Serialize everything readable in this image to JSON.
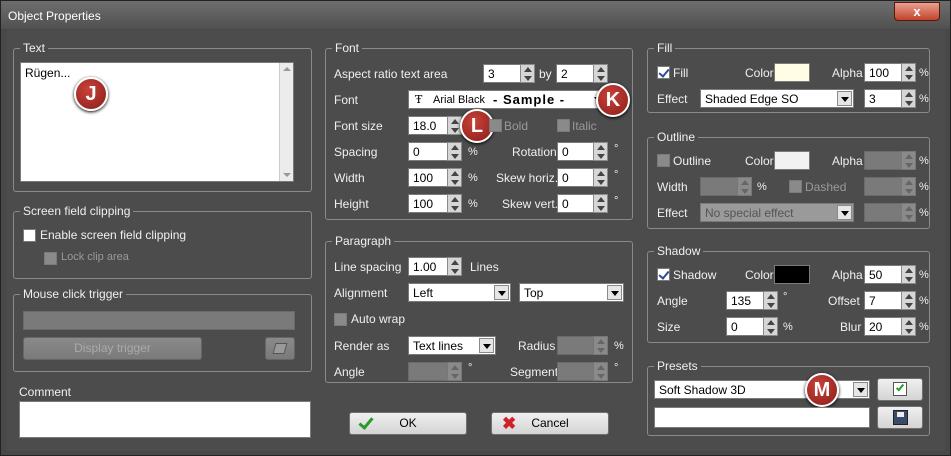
{
  "window": {
    "title": "Object Properties",
    "close_glyph": "x"
  },
  "text_group": {
    "title": "Text",
    "content": "Rügen..."
  },
  "clip_group": {
    "title": "Screen field clipping",
    "enable_label": "Enable screen field clipping",
    "lock_label": "Lock clip area"
  },
  "trigger_group": {
    "title": "Mouse click trigger",
    "trigger_value": "",
    "display_button": "Display trigger"
  },
  "comment": {
    "label": "Comment",
    "value": ""
  },
  "font_group": {
    "title": "Font",
    "aspect_label": "Aspect ratio text area",
    "aspect_a": "3",
    "by_label": "by",
    "aspect_b": "2",
    "font_label": "Font",
    "font_name": "Arial Black",
    "font_sample": "- Sample -",
    "size_label": "Font size",
    "size_value": "18.0",
    "bold_label": "Bold",
    "italic_label": "Italic",
    "spacing_label": "Spacing",
    "spacing_value": "0",
    "rotation_label": "Rotation",
    "rotation_value": "0",
    "width_label": "Width",
    "width_value": "100",
    "skewh_label": "Skew horiz.",
    "skewh_value": "0",
    "height_label": "Height",
    "height_value": "100",
    "skewv_label": "Skew vert.",
    "skewv_value": "0",
    "pct": "%",
    "deg": "°"
  },
  "paragraph_group": {
    "title": "Paragraph",
    "linespacing_label": "Line spacing",
    "linespacing_value": "1.00",
    "lines_label": "Lines",
    "alignment_label": "Alignment",
    "align_h": "Left",
    "align_v": "Top",
    "autowrap_label": "Auto wrap",
    "render_label": "Render as",
    "render_value": "Text lines",
    "radius_label": "Radius",
    "angle_label": "Angle",
    "segment_label": "Segment"
  },
  "fill_group": {
    "title": "Fill",
    "fill_label": "Fill",
    "color_label": "Color",
    "color": "#fffde6",
    "alpha_label": "Alpha",
    "alpha_value": "100",
    "effect_label": "Effect",
    "effect_value": "Shaded Edge SO",
    "effect_amount": "3"
  },
  "outline_group": {
    "title": "Outline",
    "outline_label": "Outline",
    "color_label": "Color",
    "color": "#f2f2f2",
    "alpha_label": "Alpha",
    "width_label": "Width",
    "dashed_label": "Dashed",
    "effect_label": "Effect",
    "effect_value": "No special effect"
  },
  "shadow_group": {
    "title": "Shadow",
    "shadow_label": "Shadow",
    "color_label": "Color",
    "color": "#000000",
    "alpha_label": "Alpha",
    "alpha_value": "50",
    "angle_label": "Angle",
    "angle_value": "135",
    "offset_label": "Offset",
    "offset_value": "7",
    "size_label": "Size",
    "size_value": "0",
    "blur_label": "Blur",
    "blur_value": "20"
  },
  "presets_group": {
    "title": "Presets",
    "preset_value": "Soft Shadow 3D",
    "name_value": ""
  },
  "buttons": {
    "ok": "OK",
    "cancel": "Cancel"
  },
  "badges": {
    "j": "J",
    "k": "K",
    "l": "L",
    "m": "M"
  },
  "colors": {
    "accent_badge": "#b0302a",
    "ok_check": "#2a9a2a",
    "cancel_x": "#d0202a"
  }
}
